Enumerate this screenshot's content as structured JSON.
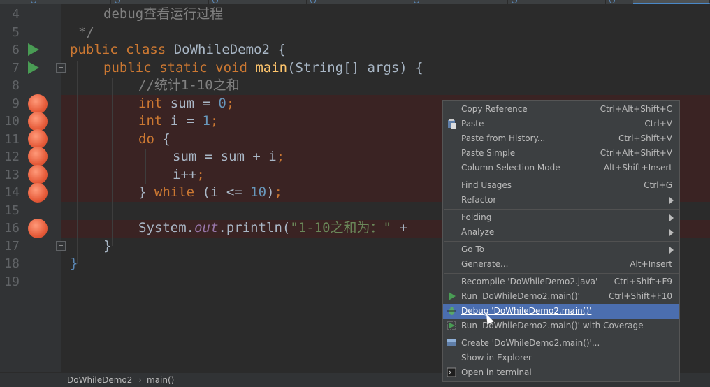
{
  "editor": {
    "line_numbers": [
      "4",
      "5",
      "6",
      "7",
      "8",
      "9",
      "10",
      "11",
      "12",
      "13",
      "14",
      "15",
      "16",
      "17",
      "18",
      "19"
    ],
    "line4": "debug查看运行过程",
    "line5": "*/",
    "line8_comment": "//统计1-10之和",
    "class_name": "DoWhileDemo2",
    "string_literal": "\"1-10之和为：\"",
    "out_field": "out",
    "println": ".println(",
    "system": "System.",
    "plus": " +"
  },
  "context_menu": {
    "items": [
      {
        "label": "Copy Reference",
        "shortcut": "Ctrl+Alt+Shift+C"
      },
      {
        "label": "Paste",
        "shortcut": "Ctrl+V",
        "icon": "clipboard-icon"
      },
      {
        "label": "Paste from History...",
        "shortcut": "Ctrl+Shift+V"
      },
      {
        "label": "Paste Simple",
        "shortcut": "Ctrl+Alt+Shift+V"
      },
      {
        "label": "Column Selection Mode",
        "shortcut": "Alt+Shift+Insert"
      },
      {
        "label": "Find Usages",
        "shortcut": "Ctrl+G"
      },
      {
        "label": "Refactor",
        "submenu": true
      },
      {
        "label": "Folding",
        "submenu": true
      },
      {
        "label": "Analyze",
        "submenu": true
      },
      {
        "label": "Go To",
        "submenu": true
      },
      {
        "label": "Generate...",
        "shortcut": "Alt+Insert"
      },
      {
        "label": "Recompile 'DoWhileDemo2.java'",
        "shortcut": "Ctrl+Shift+F9"
      },
      {
        "label": "Run 'DoWhileDemo2.main()'",
        "shortcut": "Ctrl+Shift+F10",
        "icon": "run-icon"
      },
      {
        "label": "Debug 'DoWhileDemo2.main()'",
        "selected": true,
        "icon": "debug-icon"
      },
      {
        "label": "Run 'DoWhileDemo2.main()' with Coverage",
        "icon": "coverage-icon"
      },
      {
        "label": "Create 'DoWhileDemo2.main()'...",
        "icon": "create-config-icon"
      },
      {
        "label": "Show in Explorer"
      },
      {
        "label": "Open in terminal",
        "icon": "terminal-icon"
      }
    ]
  },
  "breadcrumb": {
    "items": [
      "DoWhileDemo2",
      "main()"
    ]
  },
  "colors": {
    "editor_bg": "#2b2b2b",
    "breakpoint_line_bg": "#3a2323",
    "menu_bg": "#3c3f41",
    "menu_selected": "#4b6eaf",
    "keyword": "#cc7832",
    "number": "#6897bb",
    "string": "#6a8759"
  }
}
